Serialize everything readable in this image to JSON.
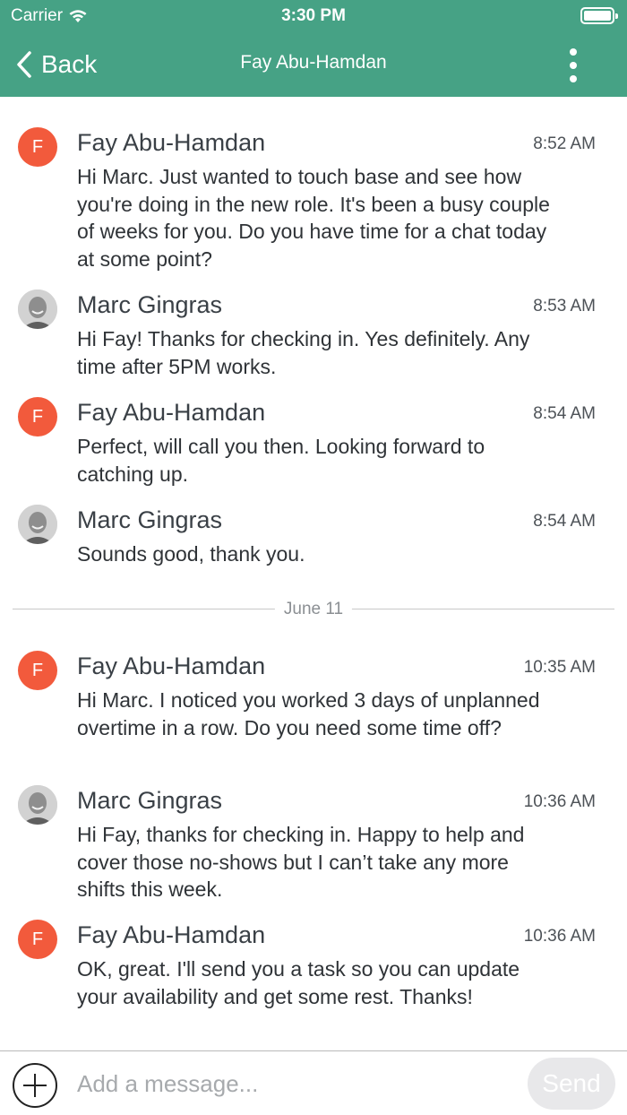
{
  "status_bar": {
    "carrier": "Carrier",
    "time": "3:30 PM"
  },
  "nav": {
    "back_label": "Back",
    "title": "Fay Abu-Hamdan"
  },
  "colors": {
    "header": "#46a285",
    "avatar_fay": "#f25a3c",
    "send_disabled": "#e8e8ea"
  },
  "messages": [
    {
      "sender": "Fay Abu-Hamdan",
      "avatar_letter": "F",
      "time": "8:52 AM",
      "text": "Hi Marc. Just wanted to touch base and see how you're doing in the new role. It's been a busy couple of weeks for you. Do you have time for a chat today at some point?"
    },
    {
      "sender": "Marc Gingras",
      "time": "8:53 AM",
      "text": "Hi Fay! Thanks for checking in. Yes definitely. Any time after 5PM works."
    },
    {
      "sender": "Fay Abu-Hamdan",
      "avatar_letter": "F",
      "time": "8:54 AM",
      "text": "Perfect, will call you then. Looking forward to catching up."
    },
    {
      "sender": "Marc Gingras",
      "time": "8:54 AM",
      "text": "Sounds good, thank you."
    },
    {
      "sender": "Fay Abu-Hamdan",
      "avatar_letter": "F",
      "time": "10:35 AM",
      "text": "Hi Marc. I noticed you worked 3 days of unplanned overtime in a row. Do you need some time off?"
    },
    {
      "sender": "Marc Gingras",
      "time": "10:36 AM",
      "text": "Hi Fay, thanks for checking in. Happy to help and cover those no-shows but I can’t take any more shifts this week."
    },
    {
      "sender": "Fay Abu-Hamdan",
      "avatar_letter": "F",
      "time": "10:36 AM",
      "text": "OK, great. I'll send you a task so you can update your availability and get some rest. Thanks!"
    }
  ],
  "date_divider": "June 11",
  "composer": {
    "placeholder": "Add a message...",
    "send_label": "Send"
  }
}
